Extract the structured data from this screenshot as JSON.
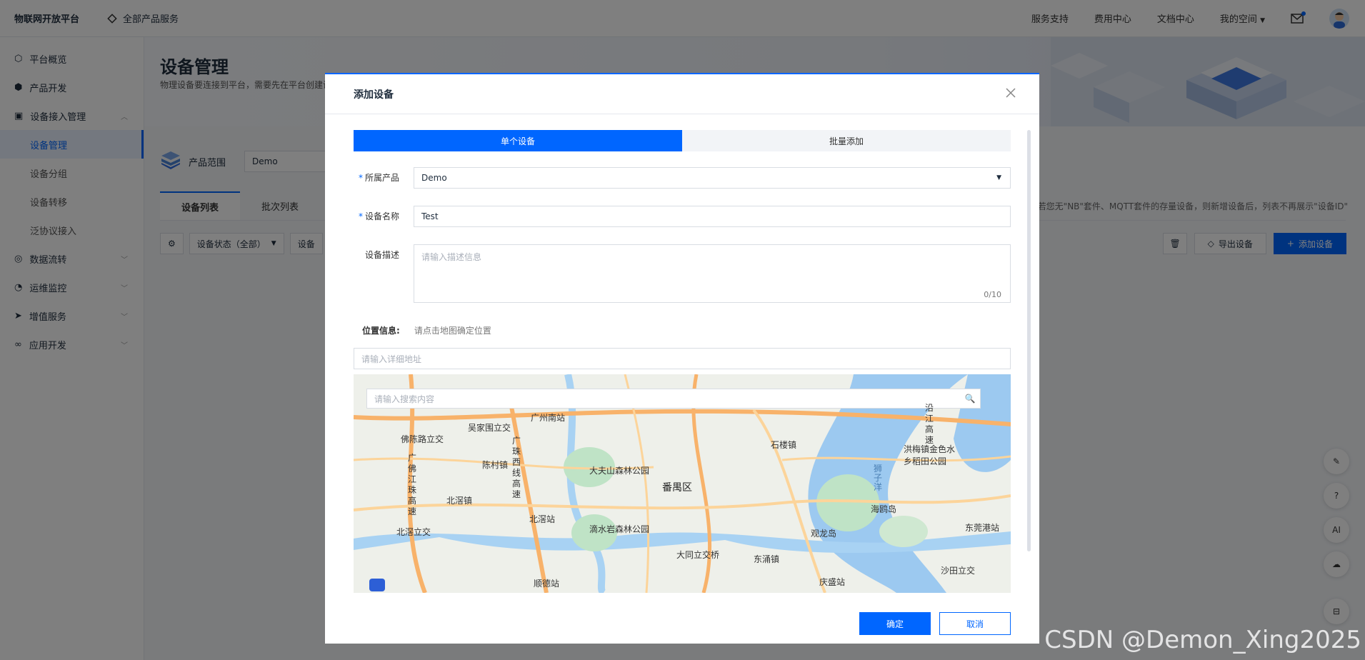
{
  "topbar": {
    "brand": "物联网开放平台",
    "all_products": "全部产品服务",
    "nav": [
      "服务支持",
      "费用中心",
      "文档中心",
      "我的空间"
    ]
  },
  "sidebar": {
    "items": [
      {
        "label": "平台概览",
        "icon": "overview-icon"
      },
      {
        "label": "产品开发",
        "icon": "cube-icon"
      },
      {
        "label": "设备接入管理",
        "icon": "device-icon"
      },
      {
        "label": "设备管理",
        "sub": true,
        "active": true
      },
      {
        "label": "设备分组",
        "sub": true
      },
      {
        "label": "设备转移",
        "sub": true
      },
      {
        "label": "泛协议接入",
        "sub": true
      },
      {
        "label": "数据流转",
        "icon": "flow-icon"
      },
      {
        "label": "运维监控",
        "icon": "monitor-icon"
      },
      {
        "label": "增值服务",
        "icon": "send-icon"
      },
      {
        "label": "应用开发",
        "icon": "link-icon"
      }
    ]
  },
  "page": {
    "title": "设备管理",
    "desc": "物理设备要连接到平台，需要先在平台创建设",
    "scope_label": "产品范围",
    "scope_value": "Demo",
    "tabs": [
      "设备列表",
      "批次列表"
    ],
    "hint": "若您无\"NB\"套件、MQTT套件的存量设备，则新增设备后，列表不再展示\"设备ID\"",
    "filter_status": "设备状态（全部）",
    "filter_2": "设备",
    "export_label": "导出设备",
    "add_label": "添加设备"
  },
  "float_tools": [
    "edit-icon",
    "help-icon",
    "AI",
    "cloud-icon",
    "collapse-icon"
  ],
  "modal": {
    "title": "添加设备",
    "segments": [
      "单个设备",
      "批量添加"
    ],
    "product_label": "所属产品",
    "product_value": "Demo",
    "name_label": "设备名称",
    "name_value": "Test",
    "desc_label": "设备描述",
    "desc_placeholder": "请输入描述信息",
    "desc_counter": "0/10",
    "location_label": "位置信息:",
    "location_hint": "请点击地图确定位置",
    "address_placeholder": "请输入详细地址",
    "map_search_placeholder": "请输入搜索内容",
    "ok": "确定",
    "cancel": "取消"
  },
  "map_labels": [
    {
      "t": "广州南站"
    },
    {
      "t": "吴家围立交"
    },
    {
      "t": "佛陈路立交"
    },
    {
      "t": "陈村镇"
    },
    {
      "t": "大夫山森林公园"
    },
    {
      "t": "番禺区"
    },
    {
      "t": "石楼镇"
    },
    {
      "t": "洪梅镇金色水乡稻田公园"
    },
    {
      "t": "北滘镇"
    },
    {
      "t": "北滘站"
    },
    {
      "t": "滴水岩森林公园"
    },
    {
      "t": "海鸥岛"
    },
    {
      "t": "观龙岛"
    },
    {
      "t": "东莞港站"
    },
    {
      "t": "北滘立交"
    },
    {
      "t": "大同立交桥"
    },
    {
      "t": "东涌镇"
    },
    {
      "t": "庆盛站"
    },
    {
      "t": "顺德站"
    },
    {
      "t": "沙田立交"
    },
    {
      "t": "广佛江珠高速"
    },
    {
      "t": "广珠西线高速"
    },
    {
      "t": "狮子洋"
    },
    {
      "t": "沿江高速"
    }
  ],
  "watermark": "CSDN @Demon_Xing2025"
}
